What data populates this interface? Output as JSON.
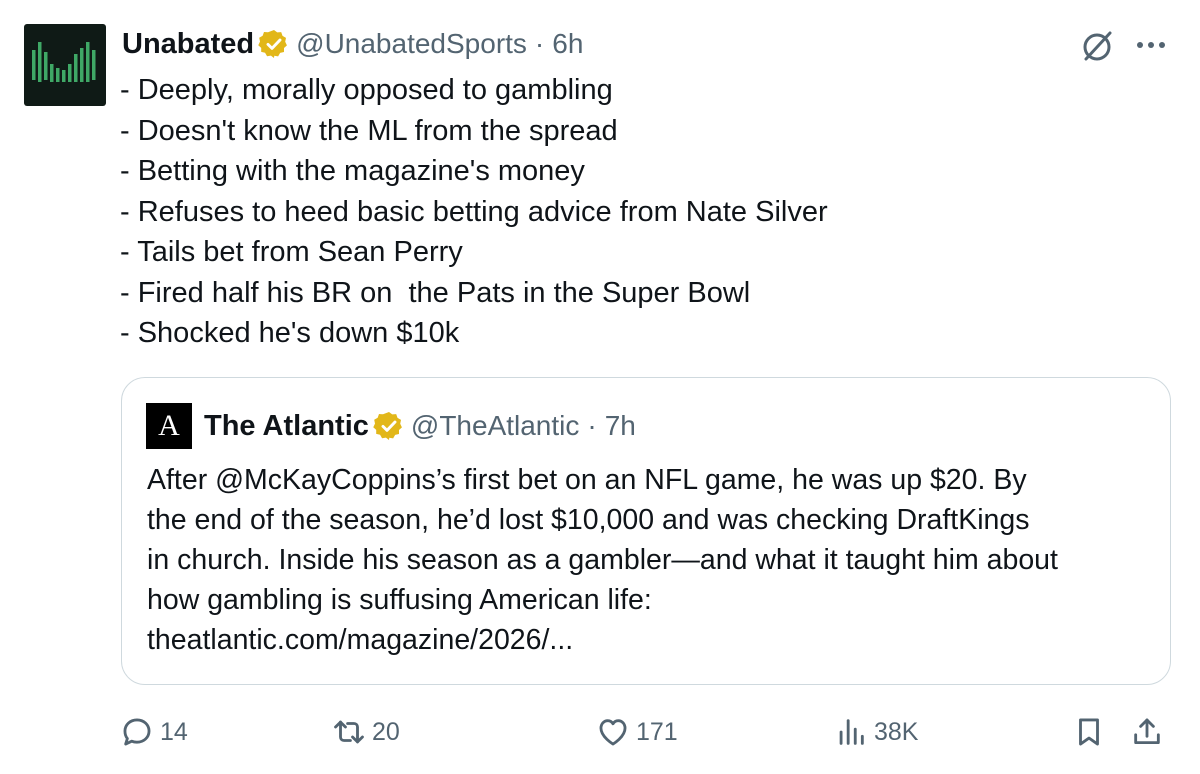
{
  "tweet": {
    "author_name": "Unabated",
    "handle": "@UnabatedSports",
    "separator": "·",
    "time": "6h",
    "lines": [
      "- Deeply, morally opposed to gambling",
      "- Doesn't know the ML from the spread",
      "- Betting with the magazine's money",
      "- Refuses to heed basic betting advice from Nate Silver",
      "- Tails bet from Sean Perry",
      "- Fired half his BR on  the Pats in the Super Bowl",
      "- Shocked he's down $10k"
    ]
  },
  "quote": {
    "avatar_letter": "A",
    "author_name": "The Atlantic",
    "handle": "@TheAtlantic",
    "separator": "·",
    "time": "7h",
    "text_lines": [
      "After @McKayCoppins’s first bet on an NFL game, he was up $20. By",
      "the end of the season, he’d lost $10,000 and was checking DraftKings",
      "in church. Inside his season as a gambler—and what it taught him about",
      "how gambling is suffusing American life:",
      "theatlantic.com/magazine/2026/..."
    ]
  },
  "actions": {
    "reply_count": "14",
    "retweet_count": "20",
    "like_count": "171",
    "views_count": "38K"
  },
  "colors": {
    "text": "#0f1419",
    "muted": "#536471",
    "border": "#cfd9de",
    "verified_gold": "#e2b719",
    "avatar_bg": "#0f1a16",
    "avatar_bars": "#3fa866"
  },
  "icons": {
    "avatar": "unabated-logo",
    "verified": "verified-badge-icon",
    "grok": "grok-icon",
    "more": "more-icon",
    "reply": "reply-icon",
    "retweet": "retweet-icon",
    "like": "like-icon",
    "views": "views-icon",
    "bookmark": "bookmark-icon",
    "share": "share-icon"
  }
}
